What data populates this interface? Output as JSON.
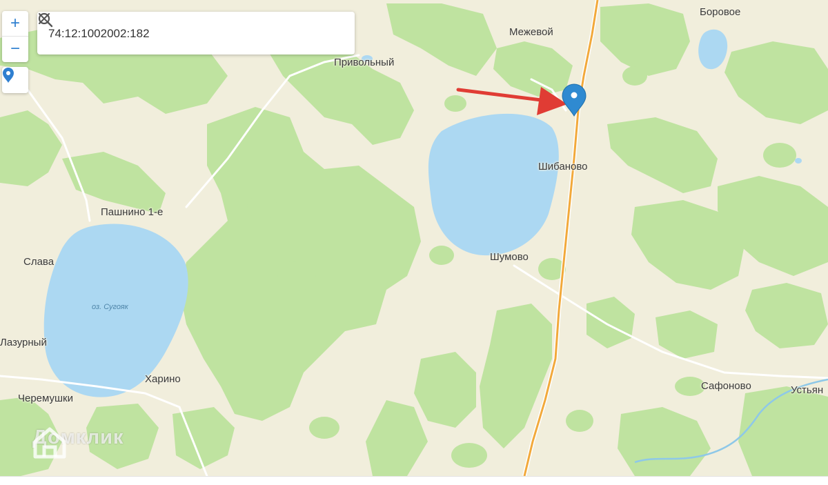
{
  "search": {
    "value": "74:12:1002002:182"
  },
  "zoom": {
    "in_label": "+",
    "out_label": "−"
  },
  "places": {
    "borovoe": "Боровое",
    "mezhevoy": "Межевой",
    "privolny": "Привольный",
    "shibanovo": "Шибаново",
    "pashnino": "Пашнино 1-е",
    "slava": "Слава",
    "shumovo": "Шумово",
    "lazurny": "Лазурный",
    "kharino": "Харино",
    "cheremushki": "Черемушки",
    "safonovo": "Сафоново",
    "ustyany": "Устьян"
  },
  "lakes": {
    "sugoyak": "оз. Сугояк"
  },
  "watermark": {
    "text": "Домклик"
  },
  "icons": {
    "search": "search-icon",
    "clear": "close-icon",
    "locate": "location-pin-icon",
    "marker": "map-marker-icon",
    "arrow": "red-arrow-annotation",
    "logo": "house-logo-icon"
  },
  "colors": {
    "land": "#f1eedc",
    "forest": "#bfe3a0",
    "water": "#acd8f2",
    "road": "#f2a93b",
    "marker": "#2f8ad1",
    "arrow": "#e03c34",
    "accent": "#2f7fd0"
  }
}
